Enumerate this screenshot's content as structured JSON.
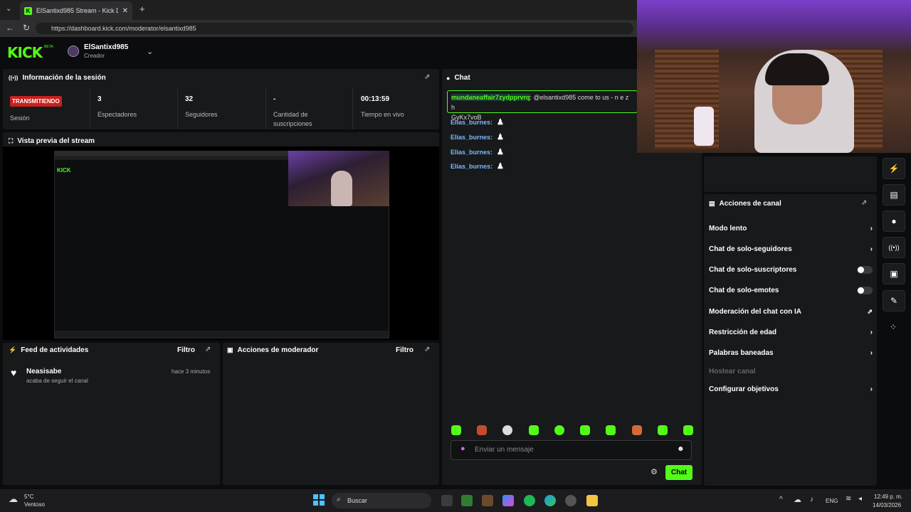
{
  "browser": {
    "tab_title": "ElSantixd985 Stream - Kick Dashb",
    "url": "https://dashboard.kick.com/moderator/elsantixd985"
  },
  "header": {
    "logo": "KICK",
    "beta": "BETA",
    "channel_name": "ElSantixd985",
    "channel_role": "Creador"
  },
  "session": {
    "title": "Información de la sesión",
    "status_badge": "TRANSMITIENDO",
    "status_label": "Sesión",
    "stats": [
      {
        "value": "3",
        "label": "Espectadores"
      },
      {
        "value": "32",
        "label": "Seguidores"
      },
      {
        "value": "-",
        "label": "Cantidad de suscripciones"
      },
      {
        "value": "00:13:59",
        "label": "Tiempo en vivo"
      }
    ]
  },
  "preview": {
    "title": "Vista previa del stream"
  },
  "feed": {
    "title": "Feed de actividades",
    "filter": "Filtro",
    "items": [
      {
        "user": "Neasisabe",
        "text": "acaba de seguir el canal",
        "time": "hace 3 minutos"
      }
    ]
  },
  "mod_actions": {
    "title": "Acciones de moderador",
    "filter": "Filtro"
  },
  "chat": {
    "title": "Chat",
    "first_user": "mundaneaffair7zydpprvrq",
    "first_text": ": @elsantixd985 come to us - n e z h",
    "first_text2": "GyKx7voB",
    "lines": [
      "Elias_burnes:",
      "Elias_burnes:",
      "Elias_burnes:",
      "Elias_burnes:"
    ],
    "input_placeholder": "Enviar un mensaje",
    "send_label": "Chat"
  },
  "channel_actions": {
    "title": "Acciones de canal",
    "items": [
      {
        "label": "Modo lento",
        "control": "arrow"
      },
      {
        "label": "Chat de solo-seguidores",
        "control": "arrow"
      },
      {
        "label": "Chat de solo-suscriptores",
        "control": "toggle"
      },
      {
        "label": "Chat de solo-emotes",
        "control": "toggle"
      },
      {
        "label": "Moderación del chat con IA",
        "control": "external"
      },
      {
        "label": "Restricción de edad",
        "control": "arrow"
      },
      {
        "label": "Palabras baneadas",
        "control": "arrow"
      },
      {
        "label": "Hostear canal",
        "control": "disabled"
      },
      {
        "label": "Configurar objetivos",
        "control": "arrow"
      }
    ]
  },
  "taskbar": {
    "weather_temp": "5°C",
    "weather_desc": "Ventoso",
    "search": "Buscar",
    "lang": "ENG",
    "time": "12:49 p. m.",
    "date": "14/03/2026"
  },
  "colors": {
    "accent": "#53fc18",
    "live": "#c8201e",
    "panel": "#18191b"
  }
}
